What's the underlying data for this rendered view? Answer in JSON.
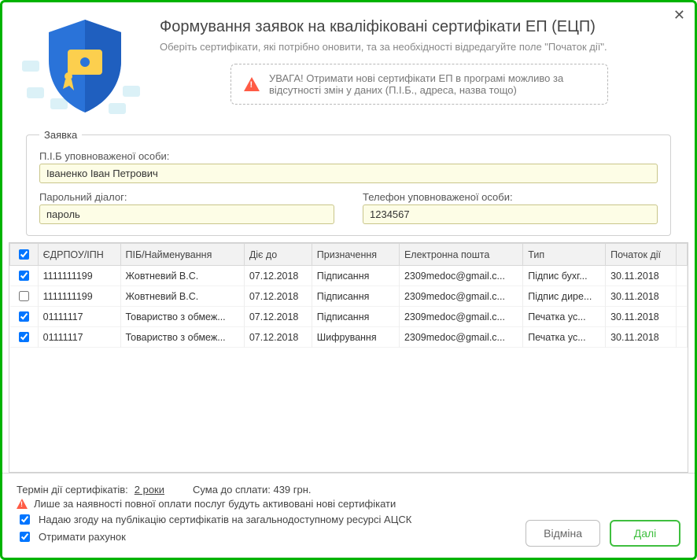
{
  "title": "Формування заявок на кваліфіковані сертифікати ЕП (ЕЦП)",
  "subtitle": "Оберіть сертифікати, які потрібно оновити, та за необхідності відредагуйте поле \"Початок дії\".",
  "warning": "УВАГА! Отримати нові сертифікати ЕП в програмі можливо за відсутності змін у даних (П.І.Б., адреса, назва тощо)",
  "fieldset_legend": "Заявка",
  "labels": {
    "pib": "П.І.Б уповноваженої особи:",
    "password_dialog": "Парольний діалог:",
    "phone": "Телефон уповноваженої особи:"
  },
  "fields": {
    "pib": "Іваненко Іван Петрович",
    "password_dialog": "пароль",
    "phone": "1234567"
  },
  "columns": [
    "ЄДРПОУ/ІПН",
    "ПІБ/Найменування",
    "Діє до",
    "Призначення",
    "Електронна пошта",
    "Тип",
    "Початок дії"
  ],
  "rows": [
    {
      "checked": true,
      "edrpou": "1111111199",
      "name": "Жовтневий В.С.",
      "valid_to": "07.12.2018",
      "purpose": "Підписання",
      "email": "2309medoc@gmail.c...",
      "type": "Підпис бухг...",
      "start": "30.11.2018"
    },
    {
      "checked": false,
      "edrpou": "1111111199",
      "name": "Жовтневий В.С.",
      "valid_to": "07.12.2018",
      "purpose": "Підписання",
      "email": "2309medoc@gmail.c...",
      "type": "Підпис дире...",
      "start": "30.11.2018"
    },
    {
      "checked": true,
      "edrpou": "01111117",
      "name": "Товариство з обмеж...",
      "valid_to": "07.12.2018",
      "purpose": "Підписання",
      "email": "2309medoc@gmail.c...",
      "type": "Печатка ус...",
      "start": "30.11.2018"
    },
    {
      "checked": true,
      "edrpou": "01111117",
      "name": "Товариство з обмеж...",
      "valid_to": "07.12.2018",
      "purpose": "Шифрування",
      "email": "2309medoc@gmail.c...",
      "type": "Печатка ус...",
      "start": "30.11.2018"
    }
  ],
  "footer": {
    "term_label": "Термін дії сертифікатів:",
    "term_value": "2 роки",
    "sum_label": "Сума до сплати: 439 грн.",
    "warning_footer": "Лише за наявності повної оплати послуг будуть активовані нові сертифікати",
    "consent1": "Надаю згоду на публікацію сертифікатів на загальнодоступному ресурсі АЦСК",
    "consent2": "Отримати рахунок",
    "consent1_checked": true,
    "consent2_checked": true
  },
  "buttons": {
    "cancel": "Відміна",
    "next": "Далі"
  }
}
